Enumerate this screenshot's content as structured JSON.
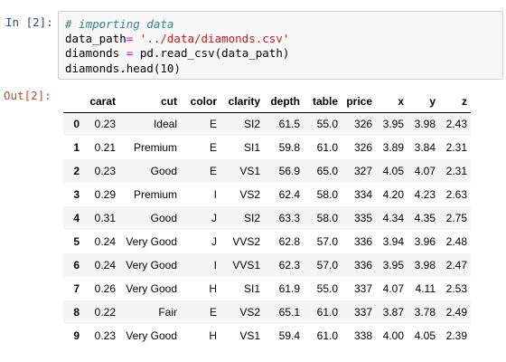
{
  "input_prompt": "In [2]:",
  "output_prompt": "Out[2]:",
  "code": {
    "line1": "# importing data",
    "line2_var": "data_path",
    "line2_op": "=",
    "line2_str": "'../data/diamonds.csv'",
    "line3_var": "diamonds",
    "line3_op": "=",
    "line3_call": "pd.read_csv(data_path)",
    "line4": "diamonds.head(10)"
  },
  "table": {
    "columns": [
      "",
      "carat",
      "cut",
      "color",
      "clarity",
      "depth",
      "table",
      "price",
      "x",
      "y",
      "z"
    ],
    "rows": [
      [
        "0",
        "0.23",
        "Ideal",
        "E",
        "SI2",
        "61.5",
        "55.0",
        "326",
        "3.95",
        "3.98",
        "2.43"
      ],
      [
        "1",
        "0.21",
        "Premium",
        "E",
        "SI1",
        "59.8",
        "61.0",
        "326",
        "3.89",
        "3.84",
        "2.31"
      ],
      [
        "2",
        "0.23",
        "Good",
        "E",
        "VS1",
        "56.9",
        "65.0",
        "327",
        "4.05",
        "4.07",
        "2.31"
      ],
      [
        "3",
        "0.29",
        "Premium",
        "I",
        "VS2",
        "62.4",
        "58.0",
        "334",
        "4.20",
        "4.23",
        "2.63"
      ],
      [
        "4",
        "0.31",
        "Good",
        "J",
        "SI2",
        "63.3",
        "58.0",
        "335",
        "4.34",
        "4.35",
        "2.75"
      ],
      [
        "5",
        "0.24",
        "Very Good",
        "J",
        "VVS2",
        "62.8",
        "57.0",
        "336",
        "3.94",
        "3.96",
        "2.48"
      ],
      [
        "6",
        "0.24",
        "Very Good",
        "I",
        "VVS1",
        "62.3",
        "57.0",
        "336",
        "3.95",
        "3.98",
        "2.47"
      ],
      [
        "7",
        "0.26",
        "Very Good",
        "H",
        "SI1",
        "61.9",
        "55.0",
        "337",
        "4.07",
        "4.11",
        "2.53"
      ],
      [
        "8",
        "0.22",
        "Fair",
        "E",
        "VS2",
        "65.1",
        "61.0",
        "337",
        "3.87",
        "3.78",
        "2.49"
      ],
      [
        "9",
        "0.23",
        "Very Good",
        "H",
        "VS1",
        "59.4",
        "61.0",
        "338",
        "4.00",
        "4.05",
        "2.39"
      ]
    ]
  }
}
